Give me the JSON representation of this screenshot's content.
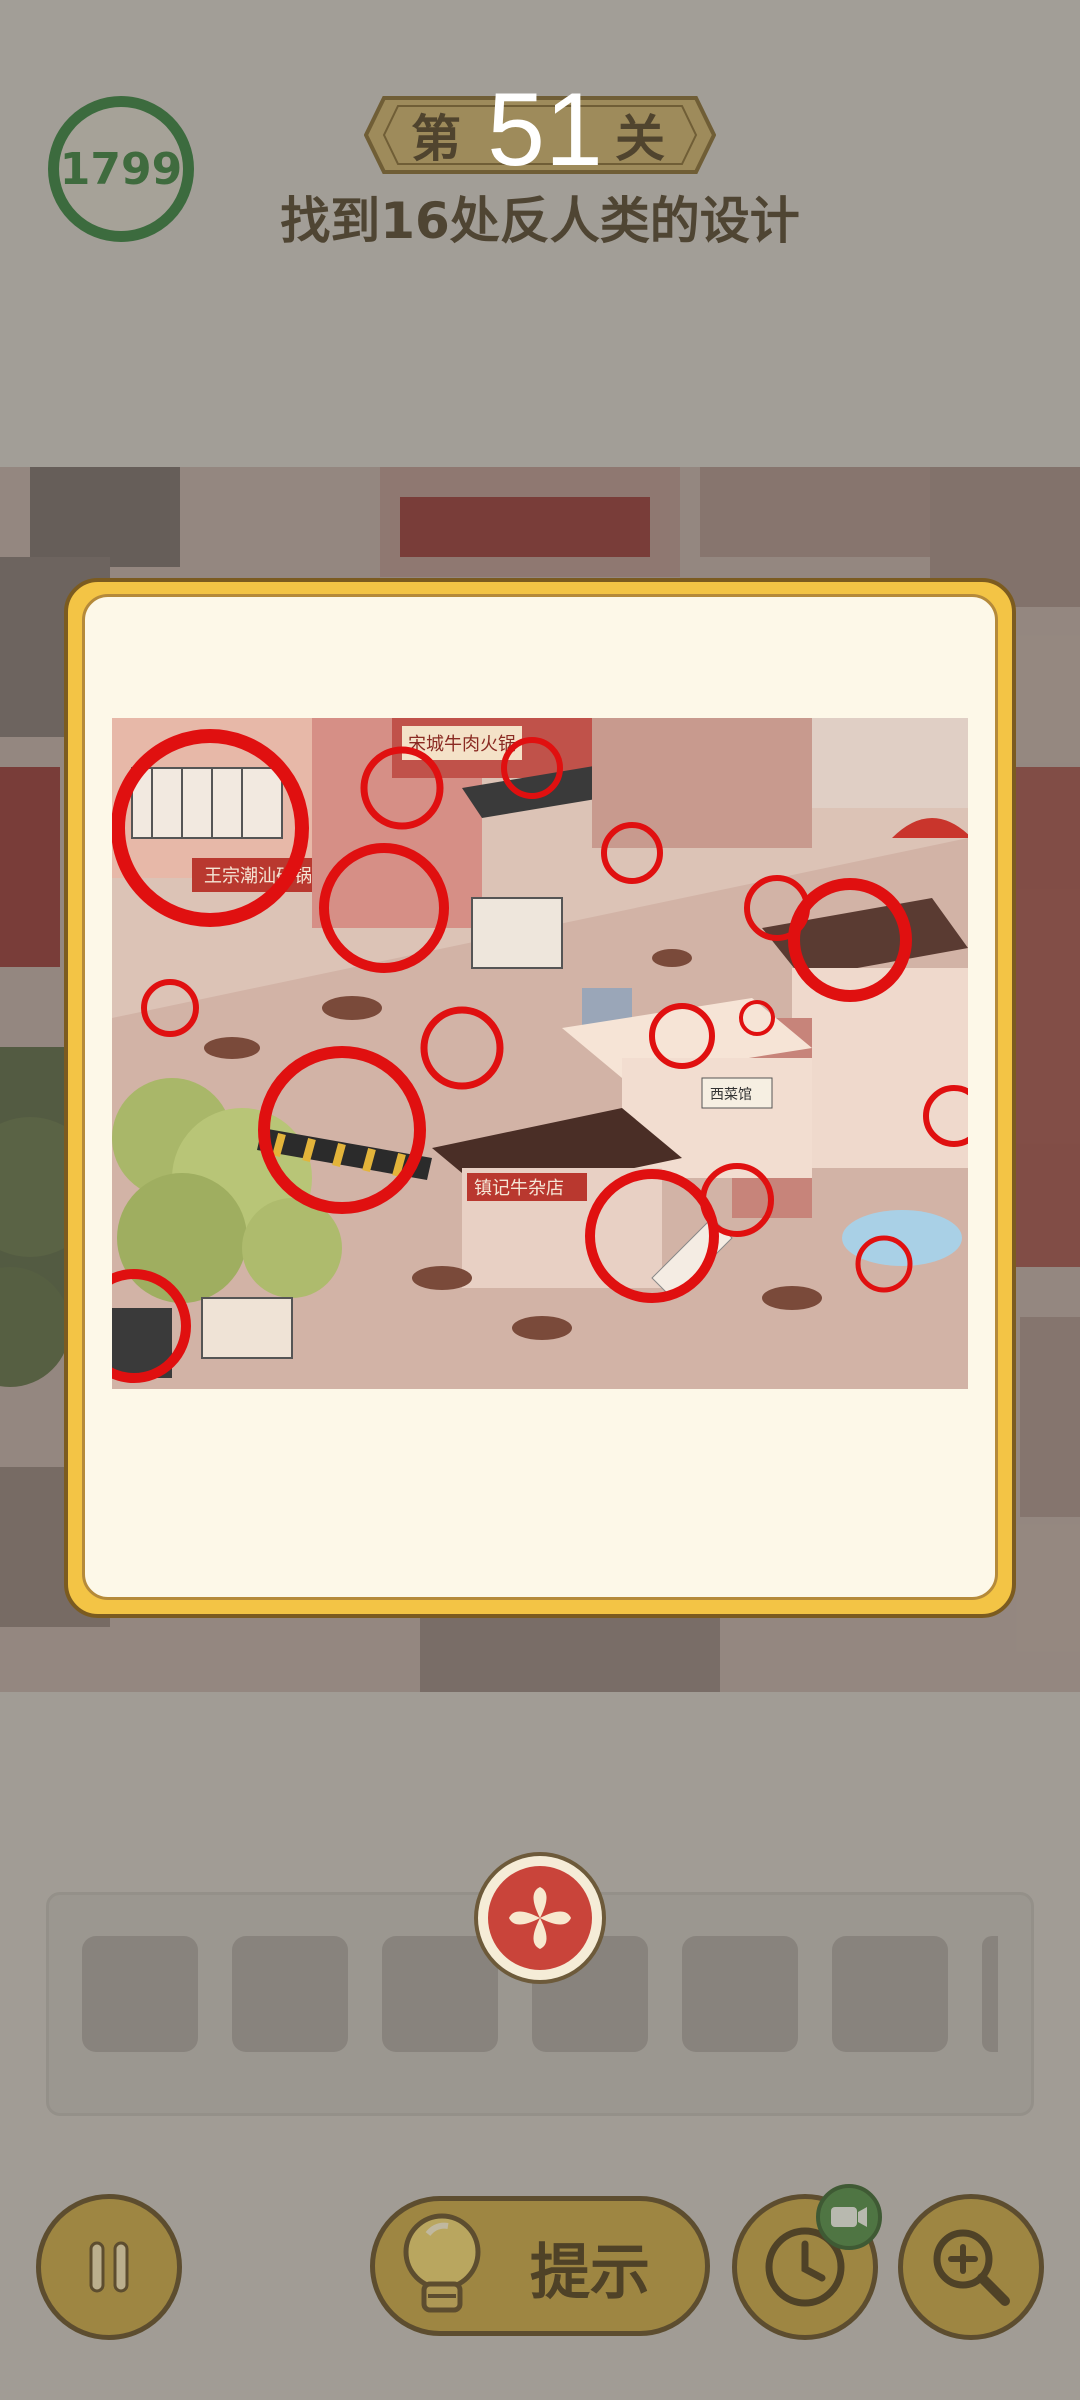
{
  "header": {
    "timer_value": "1799",
    "level_prefix": "第",
    "level_suffix": "关",
    "level_number": "51",
    "task": "找到16处反人类的设计"
  },
  "scene_signs": {
    "hotpot": "宋城牛肉火锅",
    "casserole": "王宗潮汕砂锅粥",
    "teahouse": "镇记牛杂店",
    "sign_small": "西菜馆"
  },
  "found_marks_count": 16,
  "tray": {
    "slots": 6
  },
  "buttons": {
    "hint_label": "提示",
    "pause_icon": "pause-icon",
    "time_icon": "clock-icon",
    "zoom_icon": "zoom-in-icon",
    "close_icon": "close-icon",
    "video_badge_icon": "video-icon"
  },
  "colors": {
    "accent_gold": "#c9a53b",
    "timer_green": "#2a7a34",
    "popup_border": "#f3c445",
    "mark_red": "#e01010"
  }
}
